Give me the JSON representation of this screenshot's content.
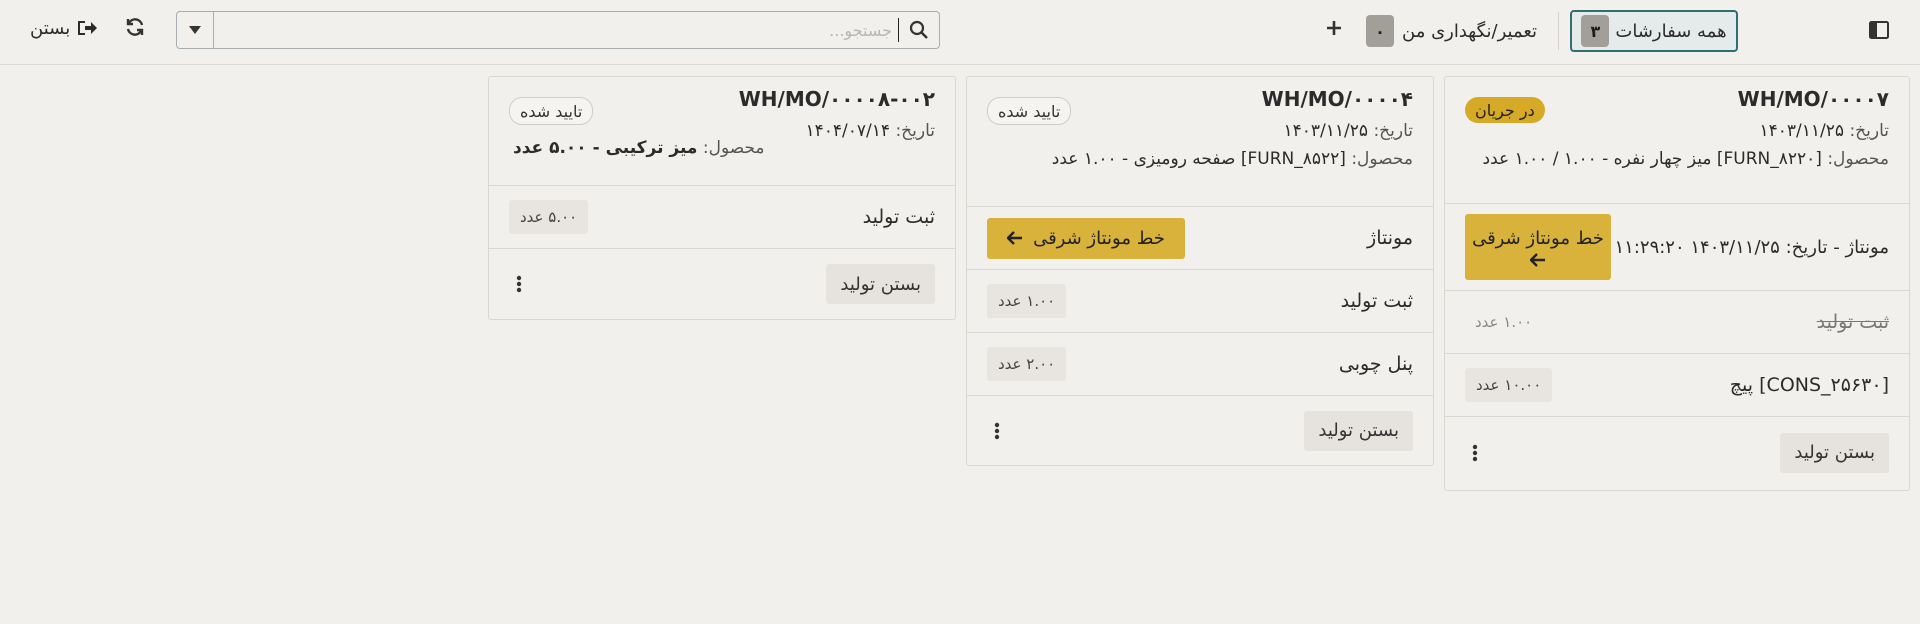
{
  "topbar": {
    "close_label": "بستن",
    "search_placeholder": "جستجو...",
    "maintenance_label": "تعمیر/نگهداری من",
    "maintenance_count": "۰",
    "all_orders_label": "همه سفارشات",
    "all_orders_count": "۳"
  },
  "cards": [
    {
      "title": "WH/MO/۰۰۰۰۷",
      "status": "در جریان",
      "date_label": "تاریخ:",
      "date": "۱۴۰۳/۱۱/۲۵",
      "product_label": "محصول:",
      "product": "[FURN_۸۲۲۰] میز چهار نفره - ۱.۰۰ / ۱.۰۰ عدد",
      "step": {
        "name": "مونتاژ",
        "date_prefix": "- تاریخ:",
        "date": "۱۴۰۳/۱۱/۲۵ ۱۱:۲۹:۲۰",
        "workcenter": "خط مونتاژ شرقی"
      },
      "register": {
        "label": "ثبت تولید",
        "qty": "۱.۰۰ عدد"
      },
      "component": {
        "label": "[CONS_۲۵۶۳۰] پیچ",
        "qty": "۱۰.۰۰ عدد"
      },
      "close_label": "بستن تولید"
    },
    {
      "title": "WH/MO/۰۰۰۰۴",
      "status": "تایید شده",
      "date_label": "تاریخ:",
      "date": "۱۴۰۳/۱۱/۲۵",
      "product_label": "محصول:",
      "product": "[FURN_۸۵۲۲] صفحه رومیزی - ۱.۰۰ عدد",
      "step": {
        "name": "مونتاژ",
        "workcenter": "خط مونتاژ شرقی"
      },
      "register": {
        "label": "ثبت تولید",
        "qty": "۱.۰۰ عدد"
      },
      "component": {
        "label": "پنل چوبی",
        "qty": "۲.۰۰ عدد"
      },
      "close_label": "بستن تولید"
    },
    {
      "title": "WH/MO/۰۰۰۰۸-۰۰۲",
      "status": "تایید شده",
      "date_label": "تاریخ:",
      "date": "۱۴۰۴/۰۷/۱۴",
      "product_label": "محصول:",
      "product": "میز ترکیبی - ۵.۰۰ عدد",
      "register": {
        "label": "ثبت تولید",
        "qty": "۵.۰۰ عدد"
      },
      "close_label": "بستن تولید"
    }
  ]
}
